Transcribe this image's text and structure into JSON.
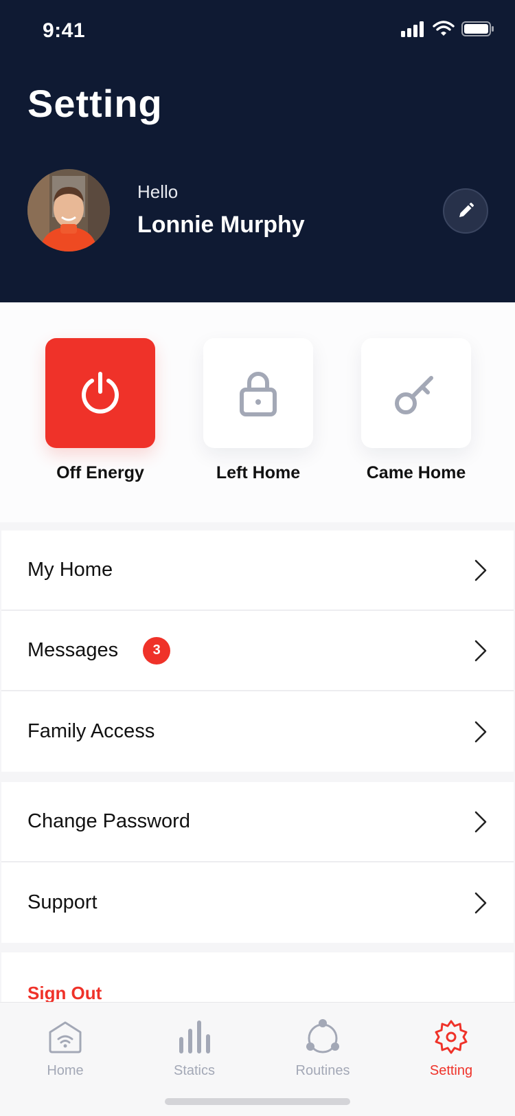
{
  "status": {
    "time": "9:41"
  },
  "header": {
    "title": "Setting",
    "greeting": "Hello",
    "user_name": "Lonnie Murphy"
  },
  "quick_actions": [
    {
      "label": "Off Energy",
      "icon": "power-icon",
      "active": true
    },
    {
      "label": "Left Home",
      "icon": "lock-icon",
      "active": false
    },
    {
      "label": "Came Home",
      "icon": "key-icon",
      "active": false
    }
  ],
  "menu": {
    "group1": [
      {
        "label": "My Home"
      },
      {
        "label": "Messages",
        "badge": "3"
      },
      {
        "label": "Family Access"
      }
    ],
    "group2": [
      {
        "label": "Change Password"
      },
      {
        "label": "Support"
      }
    ],
    "sign_out": "Sign Out"
  },
  "tabbar": [
    {
      "label": "Home",
      "icon": "home-icon",
      "active": false
    },
    {
      "label": "Statics",
      "icon": "bar-chart-icon",
      "active": false
    },
    {
      "label": "Routines",
      "icon": "routines-icon",
      "active": false
    },
    {
      "label": "Setting",
      "icon": "gear-icon",
      "active": true
    }
  ],
  "colors": {
    "header_bg": "#0f1a33",
    "accent": "#ef3229",
    "icon_gray": "#a3a8b6"
  }
}
